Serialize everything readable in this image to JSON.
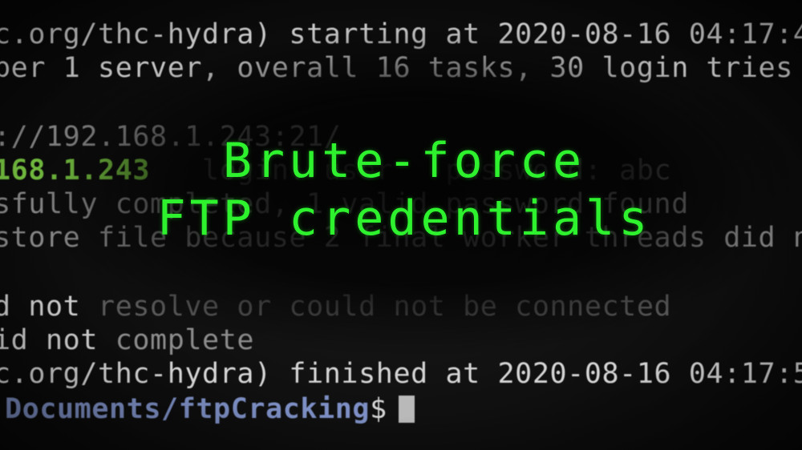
{
  "terminal": {
    "line1": "c.org/thc-hydra) starting at 2020-08-16 04:17:4",
    "line2": "per 1 server, overall 16 tasks, 30 login tries",
    "line3": "://192.168.1.243:21/",
    "line4_host": "168.1.243",
    "line4_rest": "   login: user   password: abc",
    "line5": "sfully completed, 1 valid password found",
    "line6": "store file because 2 final worker threads did n",
    "line7_a": "d not ",
    "line7_b": "resolve or could not be connected",
    "line8_a": "id not ",
    "line8_b": "complete",
    "line9": "c.org/thc-hydra) finished at 2020-08-16 04:17:5",
    "prompt_path": "Documents/ftpCracking",
    "prompt_sign": "$"
  },
  "overlay": {
    "title_line1": "Brute-force",
    "title_line2": "FTP credentials"
  },
  "colors": {
    "title": "#2df22d",
    "host": "#7ac943",
    "prompt_path": "#7d8fc4",
    "text": "#d6d6d6"
  }
}
